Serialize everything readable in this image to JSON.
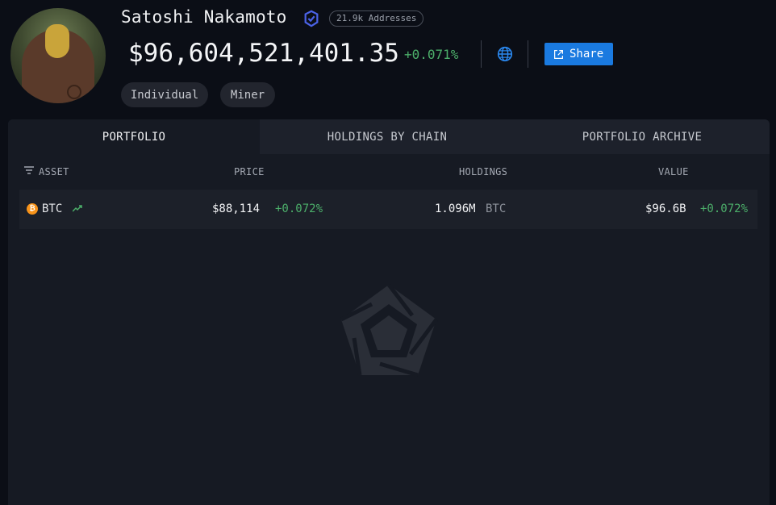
{
  "profile": {
    "name": "Satoshi Nakamoto",
    "addresses_badge": "21.9k Addresses",
    "total_value": "$96,604,521,401.35",
    "total_change": "+0.071%",
    "share_label": "Share",
    "tags": [
      "Individual",
      "Miner"
    ]
  },
  "tabs": [
    {
      "label": "PORTFOLIO",
      "active": true
    },
    {
      "label": "HOLDINGS BY CHAIN",
      "active": false
    },
    {
      "label": "PORTFOLIO ARCHIVE",
      "active": false
    }
  ],
  "table": {
    "columns": [
      "ASSET",
      "PRICE",
      "HOLDINGS",
      "VALUE"
    ],
    "rows": [
      {
        "asset": "BTC",
        "price": "$88,114",
        "price_change": "+0.072%",
        "holdings": "1.096M",
        "holdings_unit": "BTC",
        "value": "$96.6B",
        "value_change": "+0.072%"
      }
    ]
  },
  "colors": {
    "background": "#0b0e16",
    "panel": "#161a23",
    "accent_blue": "#1a7ae0",
    "positive_green": "#4caf6a",
    "verified_icon": "#4b63e8",
    "btc_orange": "#f7931a"
  },
  "icons": {
    "verified": "verified-shield-icon",
    "globe": "globe-icon",
    "share": "external-link-icon",
    "filter": "filter-icon",
    "trend": "trending-up-icon",
    "btc": "bitcoin-icon",
    "watermark": "arkham-logo-icon"
  }
}
